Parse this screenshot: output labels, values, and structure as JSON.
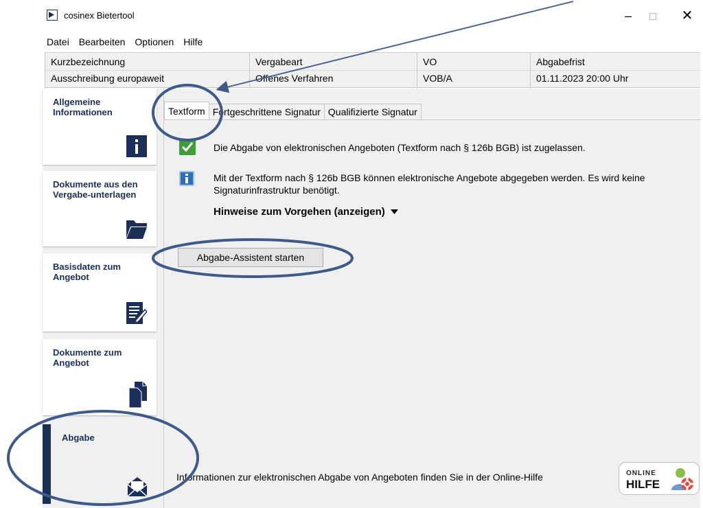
{
  "window": {
    "title": "cosinex Bietertool",
    "minimize_symbol": "–",
    "close_symbol": "✕"
  },
  "menu": [
    "Datei",
    "Bearbeiten",
    "Optionen",
    "Hilfe"
  ],
  "info_header": {
    "columns": [
      {
        "label": "Kurzbezeichnung",
        "value": "Ausschreibung europaweit"
      },
      {
        "label": "Vergabeart",
        "value": "Offenes Verfahren"
      },
      {
        "label": "VO",
        "value": "VOB/A"
      },
      {
        "label": "Abgabefrist",
        "value": "01.11.2023 20:00 Uhr"
      }
    ]
  },
  "sidebar": {
    "items": [
      {
        "label": "Allgemeine Informationen",
        "icon": "info-icon"
      },
      {
        "label": "Dokumente aus den Vergabe-unterlagen",
        "icon": "folder-icon"
      },
      {
        "label": "Basisdaten zum Angebot",
        "icon": "edit-document-icon"
      },
      {
        "label": "Dokumente zum Angebot",
        "icon": "documents-icon"
      },
      {
        "label": "Abgabe",
        "icon": "envelope-icon",
        "active": true
      }
    ]
  },
  "tabs": [
    {
      "label": "Textform",
      "active": true
    },
    {
      "label": "Fortgeschrittene Signatur"
    },
    {
      "label": "Qualifizierte Signatur"
    }
  ],
  "content": {
    "status_text": "Die Abgabe von elektronischen Angeboten (Textform nach § 126b BGB) ist zugelassen.",
    "info_text": "Mit der Textform nach § 126b BGB können elektronische Angebote abgegeben werden. Es wird keine Signaturinfrastruktur benötigt.",
    "hint_link": "Hinweise zum Vorgehen (anzeigen)",
    "start_button": "Abgabe-Assistent starten",
    "footer_text": "Informationen zur elektronischen Abgabe von Angeboten finden Sie in der Online-Hilfe",
    "online_help": {
      "small": "ONLINE",
      "big": "HILFE"
    }
  },
  "colors": {
    "accent": "#1c2f59",
    "annotation": "#3d5a8a",
    "check_green": "#3b9e37",
    "info_blue": "#2b6fb5"
  }
}
